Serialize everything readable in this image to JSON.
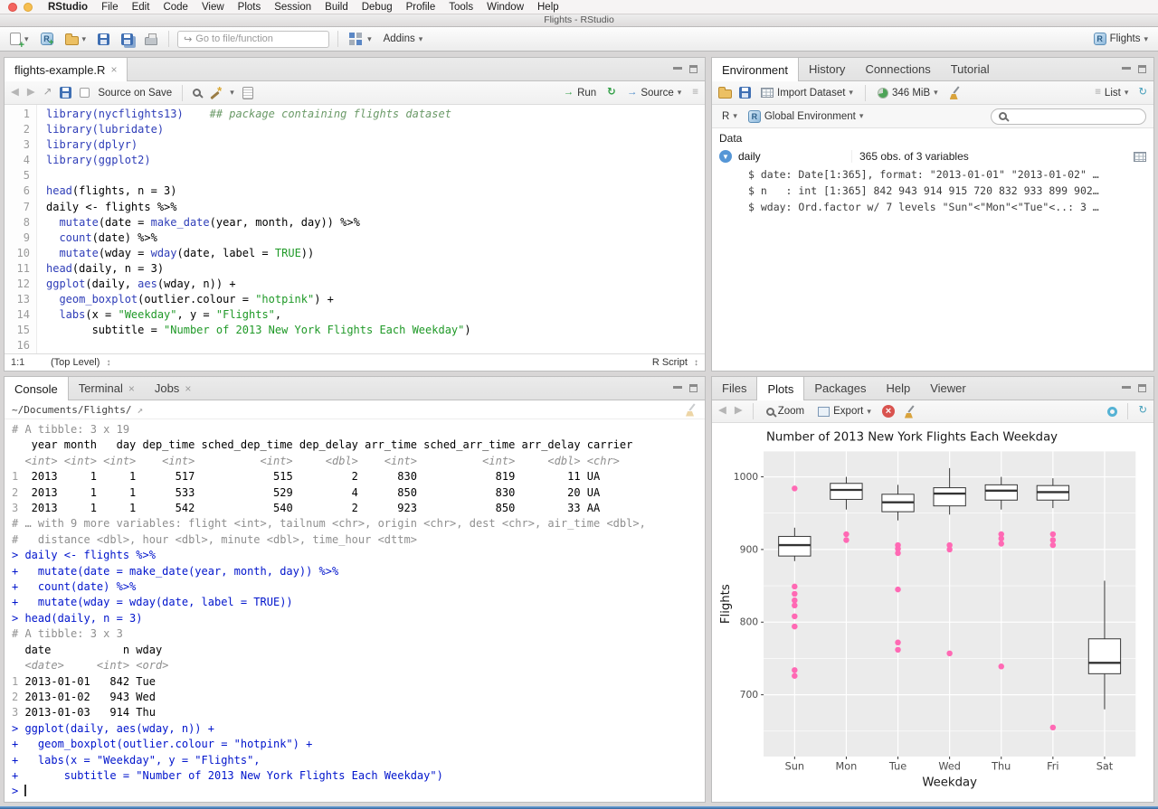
{
  "icons": {
    "caret_down": "▾",
    "close": "×",
    "back": "◀",
    "forward": "▶",
    "run_arrow": "→",
    "rerun_arrow": "↻",
    "refresh": "↻",
    "goto": "↪",
    "popout": "↗",
    "updown": "↕",
    "list": "≡",
    "outline": "≡",
    "expand": "▼"
  },
  "menubar": {
    "app_name": "RStudio",
    "items": [
      "File",
      "Edit",
      "Code",
      "View",
      "Plots",
      "Session",
      "Build",
      "Debug",
      "Profile",
      "Tools",
      "Window",
      "Help"
    ]
  },
  "titlebar": {
    "title": "Flights - RStudio"
  },
  "main_toolbar": {
    "goto_placeholder": "Go to file/function",
    "addins_label": "Addins",
    "project_label": "Flights"
  },
  "source_pane": {
    "tab_title": "flights-example.R",
    "toolbar": {
      "source_on_save": "Source on Save",
      "run": "Run",
      "source": "Source"
    },
    "status": {
      "position": "1:1",
      "scope": "(Top Level)",
      "type": "R Script"
    },
    "code": [
      {
        "n": 1,
        "segs": [
          [
            "fn",
            "library(nycflights13)"
          ],
          [
            "pl",
            "    "
          ],
          [
            "cm",
            "## package containing flights dataset"
          ]
        ]
      },
      {
        "n": 2,
        "segs": [
          [
            "fn",
            "library(lubridate)"
          ]
        ]
      },
      {
        "n": 3,
        "segs": [
          [
            "fn",
            "library(dplyr)"
          ]
        ]
      },
      {
        "n": 4,
        "segs": [
          [
            "fn",
            "library(ggplot2)"
          ]
        ]
      },
      {
        "n": 5,
        "segs": []
      },
      {
        "n": 6,
        "segs": [
          [
            "fn",
            "head"
          ],
          [
            "pl",
            "(flights, n = 3)"
          ]
        ]
      },
      {
        "n": 7,
        "segs": [
          [
            "pl",
            "daily <- flights %>%"
          ]
        ]
      },
      {
        "n": 8,
        "segs": [
          [
            "pl",
            "  "
          ],
          [
            "fn",
            "mutate"
          ],
          [
            "pl",
            "(date = "
          ],
          [
            "fn",
            "make_date"
          ],
          [
            "pl",
            "(year, month, day)) %>%"
          ]
        ]
      },
      {
        "n": 9,
        "segs": [
          [
            "pl",
            "  "
          ],
          [
            "fn",
            "count"
          ],
          [
            "pl",
            "(date) %>%"
          ]
        ]
      },
      {
        "n": 10,
        "segs": [
          [
            "pl",
            "  "
          ],
          [
            "fn",
            "mutate"
          ],
          [
            "pl",
            "(wday = "
          ],
          [
            "fn",
            "wday"
          ],
          [
            "pl",
            "(date, label = "
          ],
          [
            "str",
            "TRUE"
          ],
          [
            "pl",
            "))"
          ]
        ]
      },
      {
        "n": 11,
        "segs": [
          [
            "fn",
            "head"
          ],
          [
            "pl",
            "(daily, n = 3)"
          ]
        ]
      },
      {
        "n": 12,
        "segs": [
          [
            "fn",
            "ggplot"
          ],
          [
            "pl",
            "(daily, "
          ],
          [
            "fn",
            "aes"
          ],
          [
            "pl",
            "(wday, n)) +"
          ]
        ]
      },
      {
        "n": 13,
        "segs": [
          [
            "pl",
            "  "
          ],
          [
            "fn",
            "geom_boxplot"
          ],
          [
            "pl",
            "(outlier.colour = "
          ],
          [
            "str",
            "\"hotpink\""
          ],
          [
            "pl",
            ") +"
          ]
        ]
      },
      {
        "n": 14,
        "segs": [
          [
            "pl",
            "  "
          ],
          [
            "fn",
            "labs"
          ],
          [
            "pl",
            "(x = "
          ],
          [
            "str",
            "\"Weekday\""
          ],
          [
            "pl",
            ", y = "
          ],
          [
            "str",
            "\"Flights\""
          ],
          [
            "pl",
            ","
          ]
        ]
      },
      {
        "n": 15,
        "segs": [
          [
            "pl",
            "       subtitle = "
          ],
          [
            "str",
            "\"Number of 2013 New York Flights Each Weekday\""
          ],
          [
            "pl",
            ")"
          ]
        ]
      },
      {
        "n": 16,
        "segs": []
      }
    ]
  },
  "console_pane": {
    "tabs": [
      "Console",
      "Terminal",
      "Jobs"
    ],
    "active_tab": "Console",
    "working_dir": "~/Documents/Flights/",
    "lines": [
      {
        "segs": [
          [
            "meta",
            "# A tibble: 3 x 19"
          ]
        ]
      },
      {
        "segs": [
          [
            "out",
            "   year month   day dep_time sched_dep_time dep_delay arr_time sched_arr_time arr_delay carrier"
          ]
        ]
      },
      {
        "segs": [
          [
            "type",
            "  <int> <int> <int>    <int>          <int>     <dbl>    <int>          <int>     <dbl> <chr>"
          ]
        ]
      },
      {
        "segs": [
          [
            "idx",
            "1 "
          ],
          [
            "out",
            " 2013     1     1      517            515         2      830            819        11 UA"
          ]
        ]
      },
      {
        "segs": [
          [
            "idx",
            "2 "
          ],
          [
            "out",
            " 2013     1     1      533            529         4      850            830        20 UA"
          ]
        ]
      },
      {
        "segs": [
          [
            "idx",
            "3 "
          ],
          [
            "out",
            " 2013     1     1      542            540         2      923            850        33 AA"
          ]
        ]
      },
      {
        "segs": [
          [
            "meta",
            "# … with 9 more variables: flight <int>, tailnum <chr>, origin <chr>, dest <chr>, air_time <dbl>,"
          ]
        ]
      },
      {
        "segs": [
          [
            "meta",
            "#   distance <dbl>, hour <dbl>, minute <dbl>, time_hour <dttm>"
          ]
        ]
      },
      {
        "segs": [
          [
            "in",
            "> daily <- flights %>%"
          ]
        ]
      },
      {
        "segs": [
          [
            "in",
            "+   mutate(date = make_date(year, month, day)) %>%"
          ]
        ]
      },
      {
        "segs": [
          [
            "in",
            "+   count(date) %>%"
          ]
        ]
      },
      {
        "segs": [
          [
            "in",
            "+   mutate(wday = wday(date, label = TRUE))"
          ]
        ]
      },
      {
        "segs": [
          [
            "in",
            "> head(daily, n = 3)"
          ]
        ]
      },
      {
        "segs": [
          [
            "meta",
            "# A tibble: 3 x 3"
          ]
        ]
      },
      {
        "segs": [
          [
            "out",
            "  date           n wday"
          ]
        ]
      },
      {
        "segs": [
          [
            "type",
            "  <date>     <int> <ord>"
          ]
        ]
      },
      {
        "segs": [
          [
            "idx",
            "1 "
          ],
          [
            "out",
            "2013-01-01   842 Tue"
          ]
        ]
      },
      {
        "segs": [
          [
            "idx",
            "2 "
          ],
          [
            "out",
            "2013-01-02   943 Wed"
          ]
        ]
      },
      {
        "segs": [
          [
            "idx",
            "3 "
          ],
          [
            "out",
            "2013-01-03   914 Thu"
          ]
        ]
      },
      {
        "segs": [
          [
            "in",
            "> ggplot(daily, aes(wday, n)) +"
          ]
        ]
      },
      {
        "segs": [
          [
            "in",
            "+   geom_boxplot(outlier.colour = \"hotpink\") +"
          ]
        ]
      },
      {
        "segs": [
          [
            "in",
            "+   labs(x = \"Weekday\", y = \"Flights\","
          ]
        ]
      },
      {
        "segs": [
          [
            "in",
            "+       subtitle = \"Number of 2013 New York Flights Each Weekday\")"
          ]
        ]
      },
      {
        "segs": [
          [
            "in",
            "> "
          ]
        ],
        "cursor": true
      }
    ]
  },
  "environment_pane": {
    "tabs": [
      "Environment",
      "History",
      "Connections",
      "Tutorial"
    ],
    "active_tab": "Environment",
    "toolbar": {
      "import_label": "Import Dataset",
      "memory_label": "346 MiB",
      "list_label": "List"
    },
    "env_row": {
      "lang": "R",
      "scope": "Global Environment"
    },
    "section": "Data",
    "objects": [
      {
        "name": "daily",
        "summary": "365 obs. of 3 variables",
        "details": [
          "$ date: Date[1:365], format: \"2013-01-01\" \"2013-01-02\" …",
          "$ n   : int [1:365] 842 943 914 915 720 832 933 899 902…",
          "$ wday: Ord.factor w/ 7 levels \"Sun\"<\"Mon\"<\"Tue\"<..: 3 …"
        ]
      }
    ]
  },
  "plots_pane": {
    "tabs": [
      "Files",
      "Plots",
      "Packages",
      "Help",
      "Viewer"
    ],
    "active_tab": "Plots",
    "toolbar": {
      "zoom_label": "Zoom",
      "export_label": "Export"
    }
  },
  "chart_data": {
    "type": "boxplot",
    "title": "Number of 2013 New York Flights Each Weekday",
    "xlabel": "Weekday",
    "ylabel": "Flights",
    "categories": [
      "Sun",
      "Mon",
      "Tue",
      "Wed",
      "Thu",
      "Fri",
      "Sat"
    ],
    "ylim": [
      615,
      1035
    ],
    "yticks": [
      700,
      800,
      900,
      1000
    ],
    "yticks_minor": [
      650,
      750,
      850,
      950
    ],
    "panel_bg": "#EBEBEB",
    "outlier_color": "#FF69B4",
    "series": [
      {
        "category": "Sun",
        "whisker_low": 884,
        "q1": 891,
        "median": 906,
        "q3": 918,
        "whisker_high": 930,
        "outliers": [
          984,
          849,
          839,
          830,
          823,
          808,
          794,
          734,
          726
        ]
      },
      {
        "category": "Mon",
        "whisker_low": 955,
        "q1": 969,
        "median": 982,
        "q3": 991,
        "whisker_high": 1000,
        "outliers": [
          921,
          913
        ]
      },
      {
        "category": "Tue",
        "whisker_low": 940,
        "q1": 952,
        "median": 965,
        "q3": 976,
        "whisker_high": 989,
        "outliers": [
          906,
          901,
          895,
          845,
          772,
          762
        ]
      },
      {
        "category": "Wed",
        "whisker_low": 948,
        "q1": 960,
        "median": 977,
        "q3": 985,
        "whisker_high": 1012,
        "outliers": [
          906,
          900,
          757
        ]
      },
      {
        "category": "Thu",
        "whisker_low": 955,
        "q1": 968,
        "median": 981,
        "q3": 989,
        "whisker_high": 1000,
        "outliers": [
          921,
          915,
          908,
          739
        ]
      },
      {
        "category": "Fri",
        "whisker_low": 957,
        "q1": 968,
        "median": 979,
        "q3": 988,
        "whisker_high": 998,
        "outliers": [
          921,
          913,
          906,
          655
        ]
      },
      {
        "category": "Sat",
        "whisker_low": 680,
        "q1": 729,
        "median": 744,
        "q3": 777,
        "whisker_high": 857,
        "outliers": []
      }
    ]
  }
}
